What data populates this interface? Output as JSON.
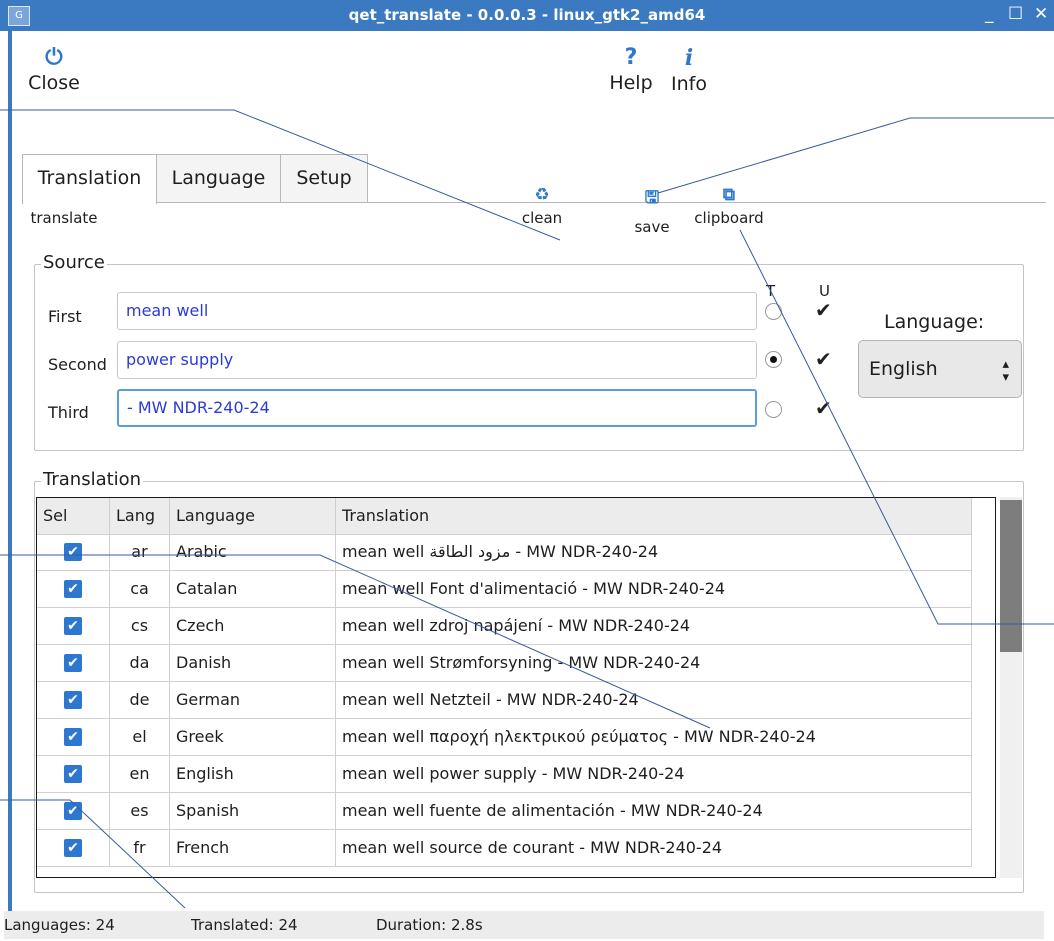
{
  "window": {
    "title": "qet_translate - 0.0.0.3 - linux_gtk2_amd64",
    "app_icon_text": "G",
    "minimize": "_",
    "maximize": "☐",
    "close": "✕"
  },
  "toolbar": {
    "close_label": "Close",
    "help_label": "Help",
    "info_label": "Info"
  },
  "tabs": [
    {
      "label": "Translation",
      "active": true
    },
    {
      "label": "Language",
      "active": false
    },
    {
      "label": "Setup",
      "active": false
    }
  ],
  "actions": {
    "translate": "translate",
    "clean": "clean",
    "save": "save",
    "clipboard": "clipboard"
  },
  "source": {
    "legend": "Source",
    "col_t": "T",
    "col_u": "U",
    "rows": [
      {
        "label": "First",
        "value": "mean well",
        "t_selected": false,
        "u_checked": true
      },
      {
        "label": "Second",
        "value": "power supply",
        "t_selected": true,
        "u_checked": true
      },
      {
        "label": "Third",
        "value": "- MW NDR-240-24",
        "t_selected": false,
        "u_checked": true
      }
    ],
    "language_label": "Language:",
    "language_value": "English"
  },
  "translation": {
    "legend": "Translation",
    "columns": [
      "Sel",
      "Lang",
      "Language",
      "Translation"
    ],
    "rows": [
      {
        "sel": true,
        "lang": "ar",
        "language": "Arabic",
        "translation": "mean well مزود الطاقة - MW NDR-240-24"
      },
      {
        "sel": true,
        "lang": "ca",
        "language": "Catalan",
        "translation": "mean well Font d'alimentació - MW NDR-240-24"
      },
      {
        "sel": true,
        "lang": "cs",
        "language": "Czech",
        "translation": "mean well zdroj napájení - MW NDR-240-24"
      },
      {
        "sel": true,
        "lang": "da",
        "language": "Danish",
        "translation": "mean well Strømforsyning - MW NDR-240-24"
      },
      {
        "sel": true,
        "lang": "de",
        "language": "German",
        "translation": "mean well Netzteil - MW NDR-240-24"
      },
      {
        "sel": true,
        "lang": "el",
        "language": "Greek",
        "translation": "mean well παροχή ηλεκτρικού ρεύματος - MW NDR-240-24"
      },
      {
        "sel": true,
        "lang": "en",
        "language": "English",
        "translation": "mean well power supply - MW NDR-240-24"
      },
      {
        "sel": true,
        "lang": "es",
        "language": "Spanish",
        "translation": "mean well fuente de alimentación - MW NDR-240-24"
      },
      {
        "sel": true,
        "lang": "fr",
        "language": "French",
        "translation": "mean well source de courant - MW NDR-240-24"
      }
    ]
  },
  "status": {
    "languages": "Languages: 24",
    "translated": "Translated: 24",
    "duration": "Duration: 2.8s"
  },
  "colors": {
    "titlebar": "#3b79c1",
    "accent": "#2d77cf",
    "input_text": "#2b3bd6",
    "callout_line": "#3a5a9c"
  }
}
